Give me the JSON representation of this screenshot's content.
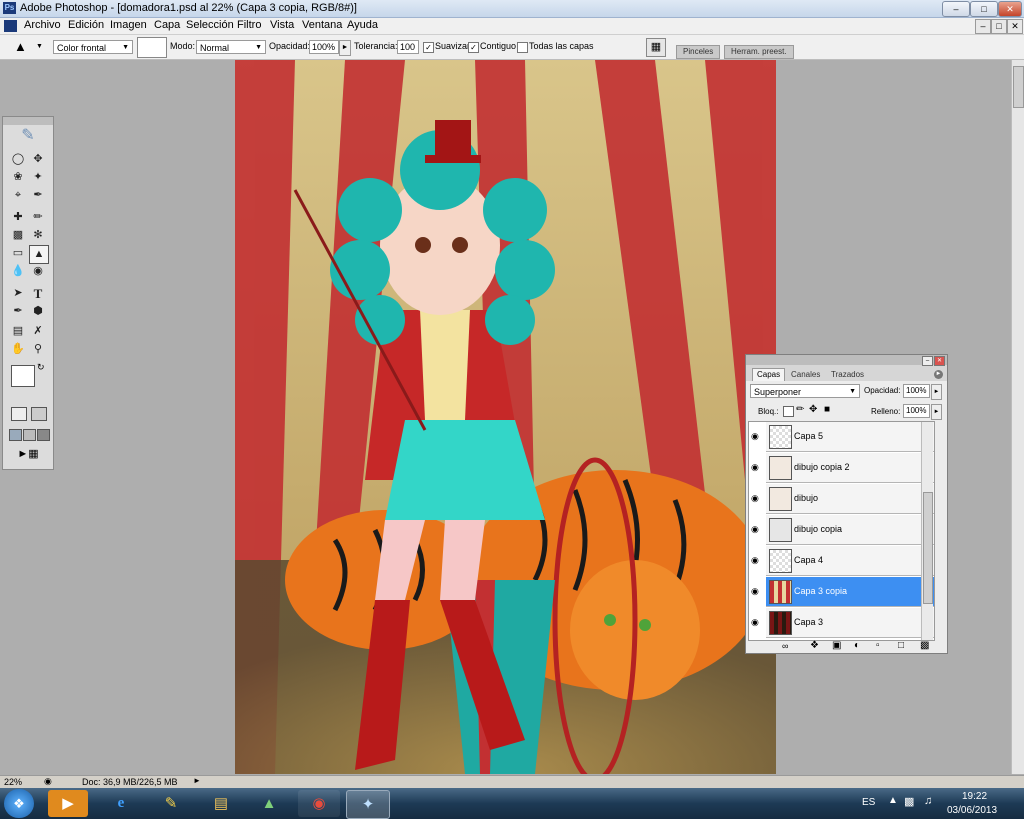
{
  "window": {
    "title": "Adobe Photoshop - [domadora1.psd al 22% (Capa 3 copia, RGB/8#)]"
  },
  "menu": [
    "Archivo",
    "Edición",
    "Imagen",
    "Capa",
    "Selección",
    "Filtro",
    "Vista",
    "Ventana",
    "Ayuda"
  ],
  "options": {
    "fill_source": "Color frontal",
    "mode_label": "Modo:",
    "mode_value": "Normal",
    "opacity_label": "Opacidad:",
    "opacity_value": "100%",
    "tolerance_label": "Tolerancia:",
    "tolerance_value": "100",
    "antialias_label": "Suavizar",
    "contiguous_label": "Contiguo",
    "all_layers_label": "Todas las capas"
  },
  "well_tabs": [
    "Pinceles",
    "Herram. preest."
  ],
  "layers_panel": {
    "tabs": [
      "Capas",
      "Canales",
      "Trazados"
    ],
    "blend_mode": "Superponer",
    "opacity_label": "Opacidad:",
    "opacity_value": "100%",
    "lock_label": "Bloq.:",
    "fill_label": "Relleno:",
    "fill_value": "100%",
    "layers": [
      {
        "name": "Capa 5",
        "selected": false
      },
      {
        "name": "dibujo copia 2",
        "selected": false
      },
      {
        "name": "dibujo",
        "selected": false
      },
      {
        "name": "dibujo copia",
        "selected": false
      },
      {
        "name": "Capa 4",
        "selected": false
      },
      {
        "name": "Capa 3 copia",
        "selected": true
      },
      {
        "name": "Capa 3",
        "selected": false
      }
    ]
  },
  "status": {
    "zoom": "22%",
    "doc": "Doc: 36,9 MB/226,5 MB"
  },
  "taskbar": {
    "lang": "ES",
    "time": "19:22",
    "date": "03/06/2013"
  },
  "colors": {
    "selected_layer": "#3d8ff2",
    "taskbar": "#1d3a55"
  }
}
